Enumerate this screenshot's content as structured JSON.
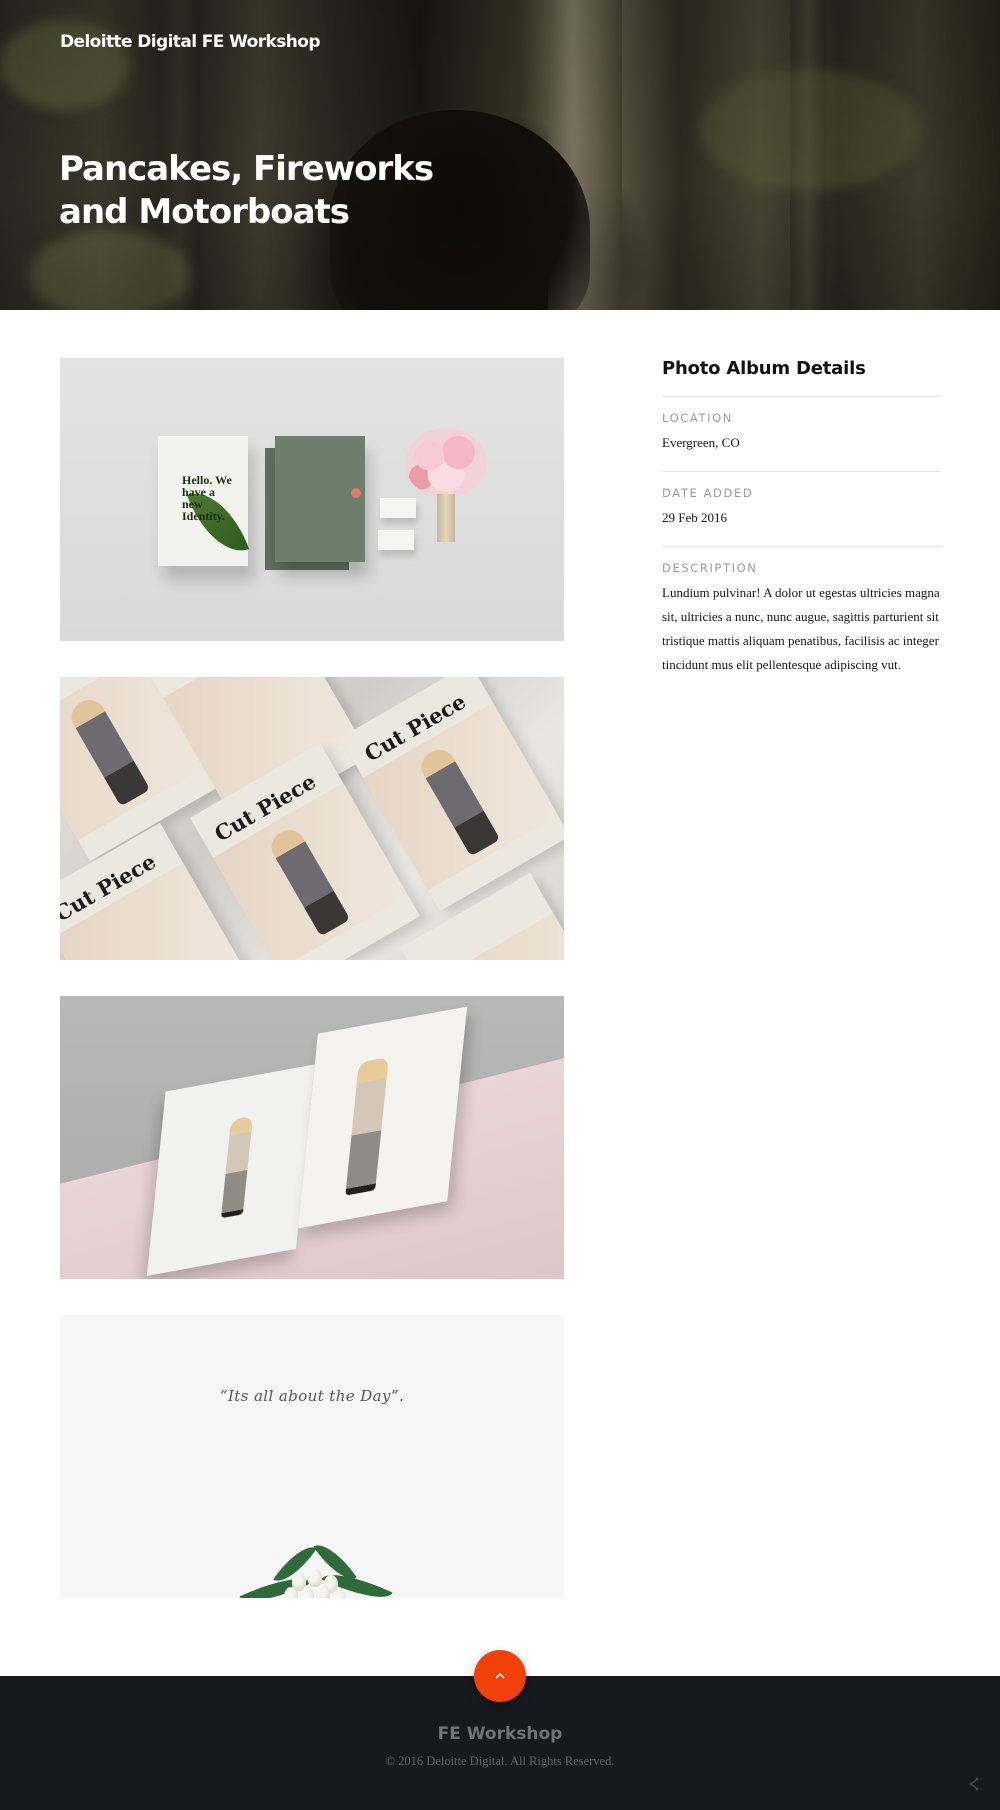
{
  "hero": {
    "brand": "Deloitte Digital FE Workshop",
    "title": "Pancakes, Fireworks and Motorboats"
  },
  "gallery": {
    "photo1": {
      "card_text": "Hello. We have a new Identity."
    },
    "photo2": {
      "magazine_title": "Cut Piece"
    },
    "photo4": {
      "quote": "“Its all about the Day”."
    }
  },
  "details": {
    "heading": "Photo Album Details",
    "location_label": "LOCATION",
    "location": "Evergreen, CO",
    "date_label": "DATE ADDED",
    "date": "29 Feb 2016",
    "description_label": "DESCRIPTION",
    "description": "Lundium pulvinar! A dolor ut egestas ultricies magna sit, ultricies a nunc, nunc augue, sagittis parturient sit tristique mattis aliquam penatibus, facilisis ac integer tincidunt mus elit pellentesque adipiscing vut."
  },
  "footer": {
    "title": "FE Workshop",
    "copyright": "© 2016 Deloitte Digital. All Rights Reserved.",
    "to_top_icon": "chevron-up-icon",
    "share_icon": "share-icon"
  },
  "colors": {
    "accent": "#f2400b",
    "footer_bg": "#16191d"
  }
}
